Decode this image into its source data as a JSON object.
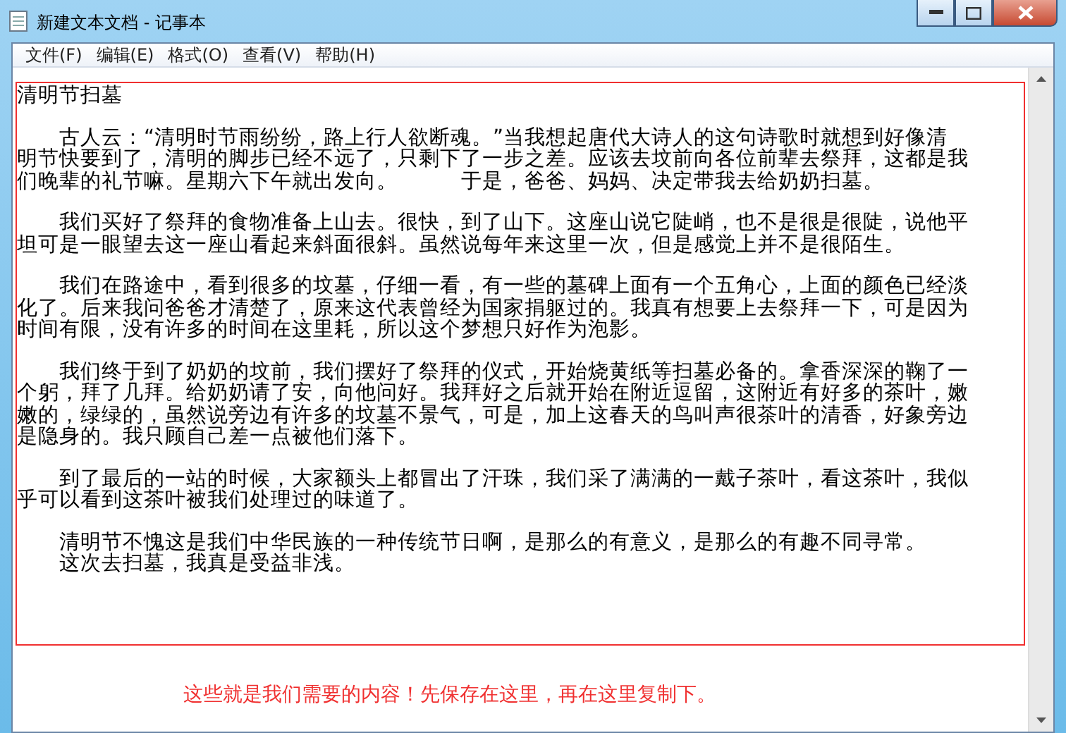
{
  "window": {
    "title": "新建文本文档 - 记事本"
  },
  "menu": [
    "文件(F)",
    "编辑(E)",
    "格式(O)",
    "查看(V)",
    "帮助(H)"
  ],
  "document": {
    "paragraphs": [
      [
        "清明节扫墓"
      ],
      [
        "　　古人云：“清明时节雨纷纷，路上行人欲断魂。”当我想起唐代大诗人的这句诗歌时就想到好像清",
        "明节快要到了，清明的脚步已经不远了，只剩下了一步之差。应该去坟前向各位前辈去祭拜，这都是我",
        "们晚辈的礼节嘛。星期六下午就出发向。　　　于是，爸爸、妈妈、决定带我去给奶奶扫墓。"
      ],
      [
        "　　我们买好了祭拜的食物准备上山去。很快，到了山下。这座山说它陡峭，也不是很是很陡，说他平",
        "坦可是一眼望去这一座山看起来斜面很斜。虽然说每年来这里一次，但是感觉上并不是很陌生。"
      ],
      [
        "　　我们在路途中，看到很多的坟墓，仔细一看，有一些的墓碑上面有一个五角心，上面的颜色已经淡",
        "化了。后来我问爸爸才清楚了，原来这代表曾经为国家捐躯过的。我真有想要上去祭拜一下，可是因为",
        "时间有限，没有许多的时间在这里耗，所以这个梦想只好作为泡影。"
      ],
      [
        "　　我们终于到了奶奶的坟前，我们摆好了祭拜的仪式，开始烧黄纸等扫墓必备的。拿香深深的鞠了一",
        "个躬，拜了几拜。给奶奶请了安，向他问好。我拜好之后就开始在附近逗留，这附近有好多的茶叶，嫩",
        "嫩的，绿绿的，虽然说旁边有许多的坟墓不景气，可是，加上这春天的鸟叫声很茶叶的清香，好象旁边",
        "是隐身的。我只顾自己差一点被他们落下。"
      ],
      [
        "　　到了最后的一站的时候，大家额头上都冒出了汗珠，我们采了满满的一戴子茶叶，看这茶叶，我似",
        "乎可以看到这茶叶被我们处理过的味道了。"
      ],
      [
        "　　清明节不愧这是我们中华民族的一种传统节日啊，是那么的有意义，是那么的有趣不同寻常。",
        "　　这次去扫墓，我真是受益非浅。"
      ]
    ]
  },
  "annotation": "这些就是我们需要的内容！先保存在这里，再在这里复制下。"
}
